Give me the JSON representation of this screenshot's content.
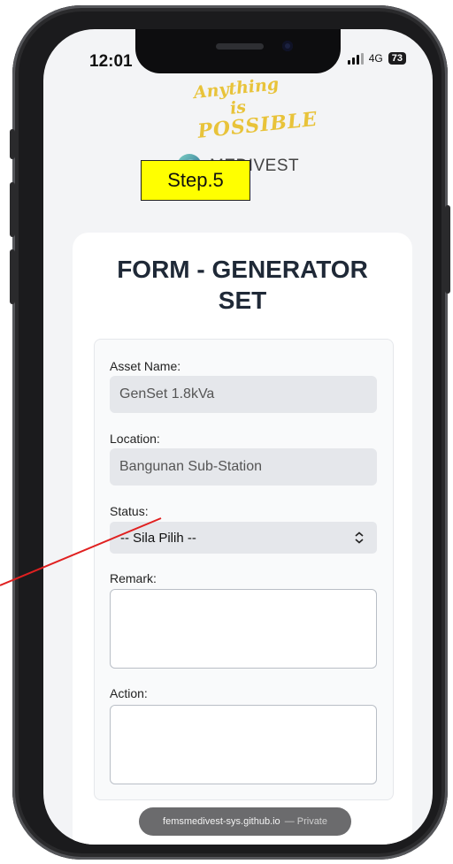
{
  "status_bar": {
    "time": "12:01",
    "network": "4G",
    "battery": "73"
  },
  "slogan": {
    "line1": "Anything is",
    "line2": "POSSIBLE"
  },
  "brand": {
    "name": "MEDIVEST"
  },
  "step_badge": "Step.5",
  "form": {
    "title_line1": "FORM - GENERATOR",
    "title_line2": "SET",
    "asset_name_label": "Asset Name:",
    "asset_name_value": "GenSet 1.8kVa",
    "location_label": "Location:",
    "location_value": "Bangunan Sub-Station",
    "status_label": "Status:",
    "status_selected": "-- Sila Pilih --",
    "remark_label": "Remark:",
    "action_label": "Action:"
  },
  "browser": {
    "url": "femsmedivest-sys.github.io",
    "privacy": "— Private"
  },
  "colors": {
    "step_badge_bg": "#ffff00",
    "annotation_arrow": "#e02020",
    "slogan": "#e8c33a"
  }
}
